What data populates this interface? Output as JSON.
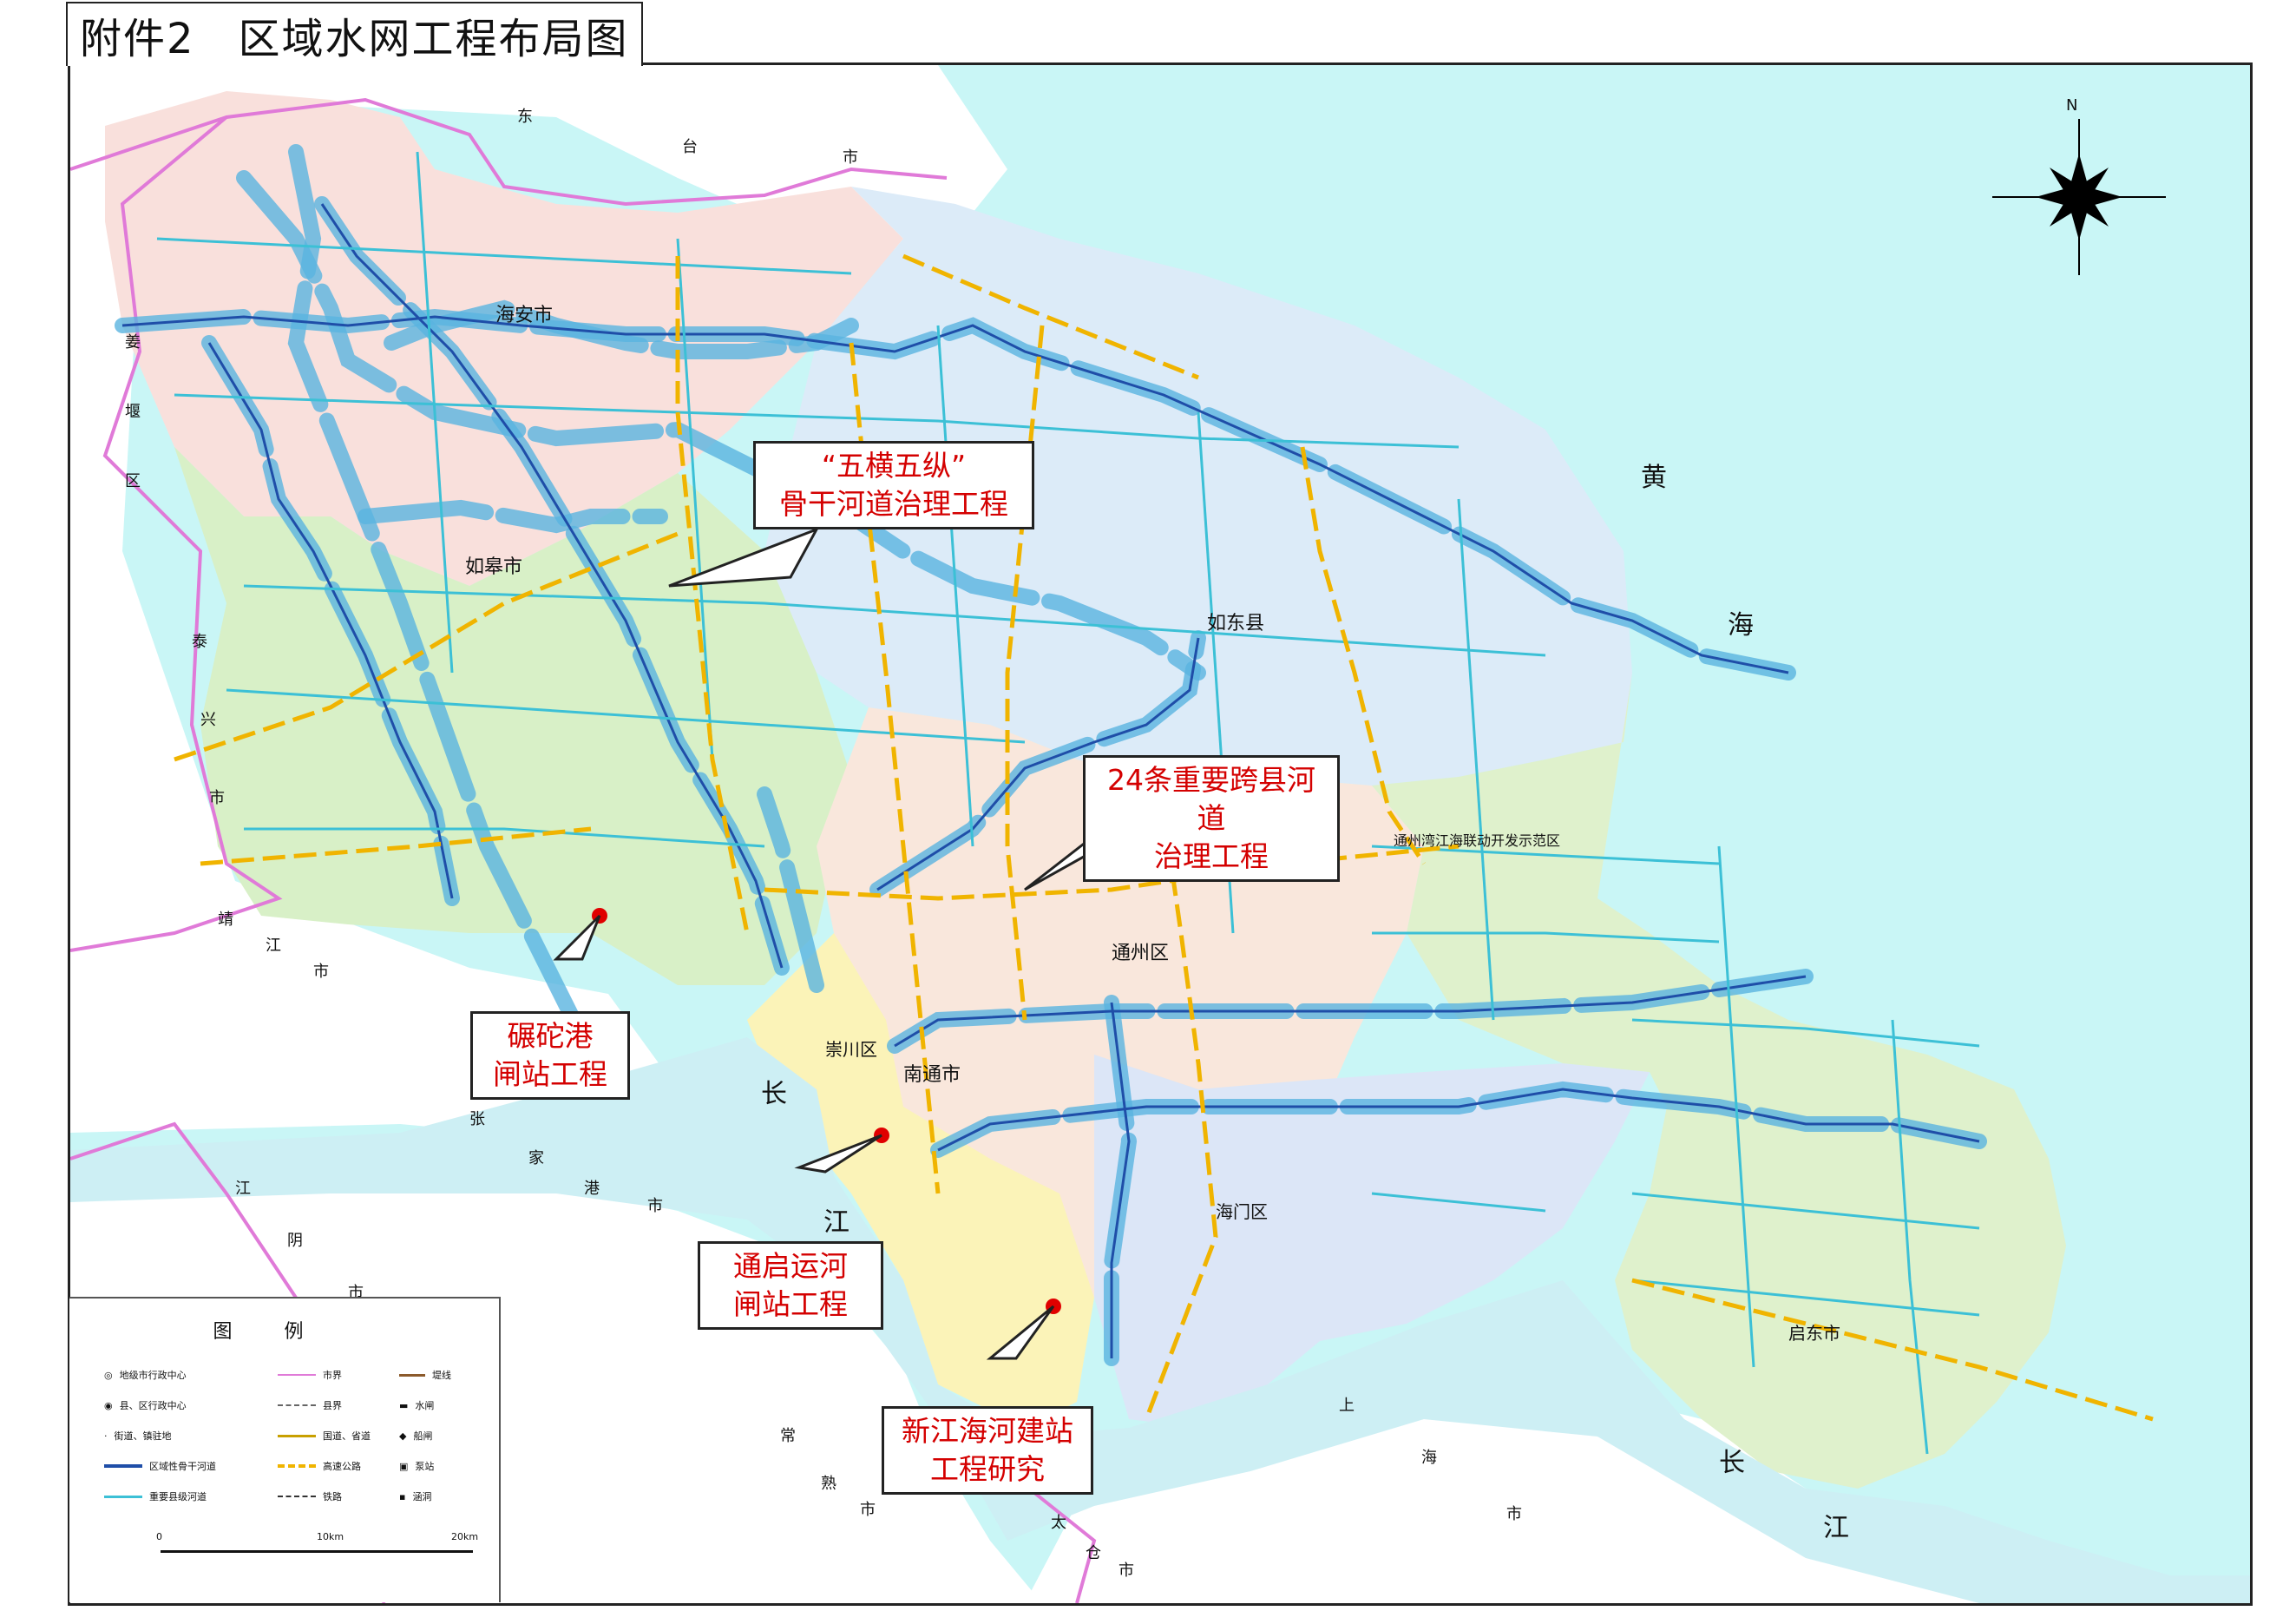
{
  "title": {
    "prefix": "附件2",
    "text": "区域水网工程布局图"
  },
  "compass": {
    "label": "N"
  },
  "callouts": {
    "wuheng": [
      "“五横五纵”",
      "骨干河道治理工程"
    ],
    "kuaxian": [
      "24条重要跨县河道",
      "治理工程"
    ],
    "niantuo": [
      "碾砣港",
      "闸站工程"
    ],
    "tongqi": [
      "通启运河",
      "闸站工程"
    ],
    "xinjiang": [
      "新江海河建站",
      "工程研究"
    ]
  },
  "places": {
    "haian": "海安市",
    "rugao": "如皋市",
    "rudong": "如东县",
    "tongzhou": "通州区",
    "chongchuan": "崇川区",
    "nantong": "南通市",
    "haimen": "海门区",
    "qidong": "启东市",
    "kaifaqu": "通州湾江海联动开发示范区",
    "huang": "黄",
    "hai": "海",
    "chang1": "长",
    "jiang1": "江",
    "chang2": "长",
    "jiang2": "江",
    "dong": "东",
    "tai": "台",
    "shi": "市",
    "jiang_yan": "姜",
    "yan": "堰",
    "qu": "区",
    "tai_xing": "泰",
    "xing": "兴",
    "shi2": "市",
    "jing": "靖",
    "jiang3": "江",
    "shi3": "市",
    "zhang": "张",
    "jia": "家",
    "gang": "港",
    "shi4": "市",
    "jiang4": "江",
    "yin": "阴",
    "shi5": "市",
    "chang3": "常",
    "shu": "熟",
    "shi6": "市",
    "shang": "上",
    "hai2": "海",
    "shi7": "市",
    "tai2": "太",
    "cang": "仓",
    "shi8": "市"
  },
  "legend": {
    "title": "图例",
    "items": [
      "地级市行政中心",
      "县、区行政中心",
      "街道、镇驻地",
      "区域性骨干河道",
      "重要县级河道",
      "市界",
      "县界",
      "国道、省道",
      "高速公路",
      "铁路",
      "堤线",
      "水闸",
      "船闸",
      "泵站",
      "涵洞"
    ],
    "scale": [
      "0",
      "10km",
      "20km"
    ]
  },
  "colors": {
    "sea": "#c9f6f6",
    "river": "#cdeff4",
    "haian": "#f9e0dc",
    "rugao": "#d8f0c7",
    "rudong": "#dcebf8",
    "tongzhou": "#f9e7dc",
    "chongchuan": "#fbf3b8",
    "haimen": "#dce6f7",
    "qidong": "#dff1cc",
    "backbone": "#5ab4e0",
    "county_river": "#3cc0d6",
    "road": "#f0b400",
    "boundary": "#e07ad8",
    "site": "#e00000"
  }
}
